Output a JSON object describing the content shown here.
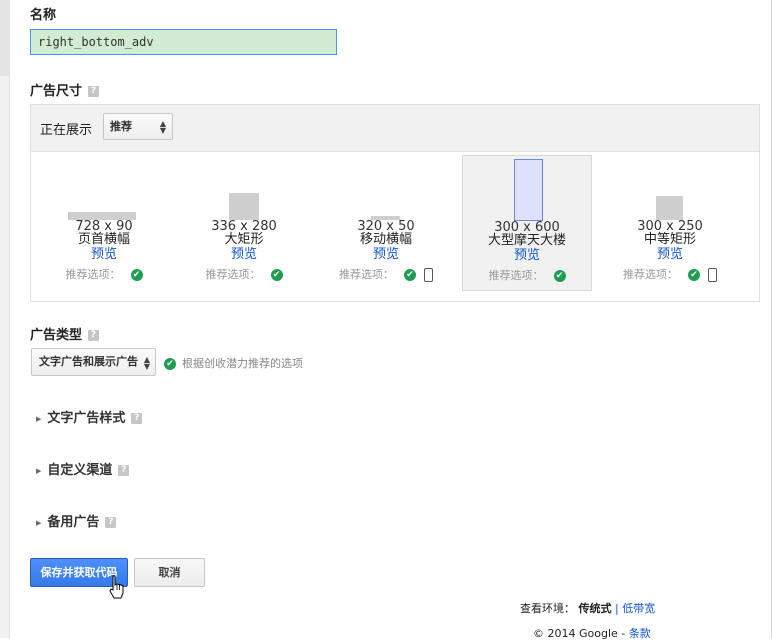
{
  "name_section": {
    "label": "名称",
    "value": "right_bottom_adv"
  },
  "size_section": {
    "label": "广告尺寸",
    "help": "?",
    "showing_label": "正在展示",
    "filter_value": "推荐",
    "ads": [
      {
        "dimensions": "728 x 90",
        "name": "页首横幅",
        "preview": "预览",
        "rec": "推荐选项：",
        "mobile": false,
        "selected": false
      },
      {
        "dimensions": "336 x 280",
        "name": "大矩形",
        "preview": "预览",
        "rec": "推荐选项：",
        "mobile": false,
        "selected": false
      },
      {
        "dimensions": "320 x 50",
        "name": "移动横幅",
        "preview": "预览",
        "rec": "推荐选项：",
        "mobile": true,
        "selected": false
      },
      {
        "dimensions": "300 x 600",
        "name": "大型摩天大楼",
        "preview": "预览",
        "rec": "推荐选项：",
        "mobile": false,
        "selected": true
      },
      {
        "dimensions": "300 x 250",
        "name": "中等矩形",
        "preview": "预览",
        "rec": "推荐选项：",
        "mobile": true,
        "selected": false
      }
    ]
  },
  "type_section": {
    "label": "广告类型",
    "help": "?",
    "select_value": "文字广告和展示广告",
    "note": "根据创收潜力推荐的选项"
  },
  "sections": [
    {
      "label": "文字广告样式",
      "help": "?"
    },
    {
      "label": "自定义渠道",
      "help": "?"
    },
    {
      "label": "备用广告",
      "help": "?"
    }
  ],
  "buttons": {
    "save": "保存并获取代码",
    "cancel": "取消"
  },
  "footer": {
    "env_label": "查看环境：",
    "env_current": "传统式",
    "separator": "|",
    "env_alt": "低带宽",
    "copyright": "© 2014 Google -",
    "terms": "条款"
  },
  "colors": {
    "link": "#1155cc",
    "primary": "#4d90fe",
    "check": "#1e9e50",
    "input_bg": "#d2ecd3"
  }
}
